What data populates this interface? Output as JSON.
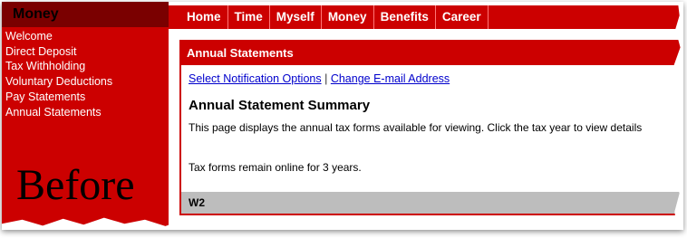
{
  "sidebar": {
    "title": "Money",
    "items": [
      {
        "label": "Welcome"
      },
      {
        "label": "Direct Deposit"
      },
      {
        "label": "Tax Withholding"
      },
      {
        "label": "Voluntary Deductions"
      },
      {
        "label": "Pay Statements"
      },
      {
        "label": "Annual Statements"
      }
    ]
  },
  "overlay_text": "Before",
  "nav": {
    "items": [
      {
        "label": "Home"
      },
      {
        "label": "Time"
      },
      {
        "label": "Myself"
      },
      {
        "label": "Money"
      },
      {
        "label": "Benefits"
      },
      {
        "label": "Career"
      }
    ]
  },
  "panel": {
    "header": "Annual Statements",
    "link_notifications": "Select Notification Options",
    "link_separator": "|",
    "link_email": "Change E-mail Address",
    "summary_title": "Annual Statement Summary",
    "description": "This page displays the annual tax forms available for viewing. Click the tax year to view details",
    "note": "Tax forms remain online for 3 years.",
    "table_header": "W2"
  },
  "colors": {
    "brand_red": "#cc0000",
    "dark_red": "#7a0000",
    "link_blue": "#0000cc",
    "table_header_gray": "#bdbdbd"
  }
}
